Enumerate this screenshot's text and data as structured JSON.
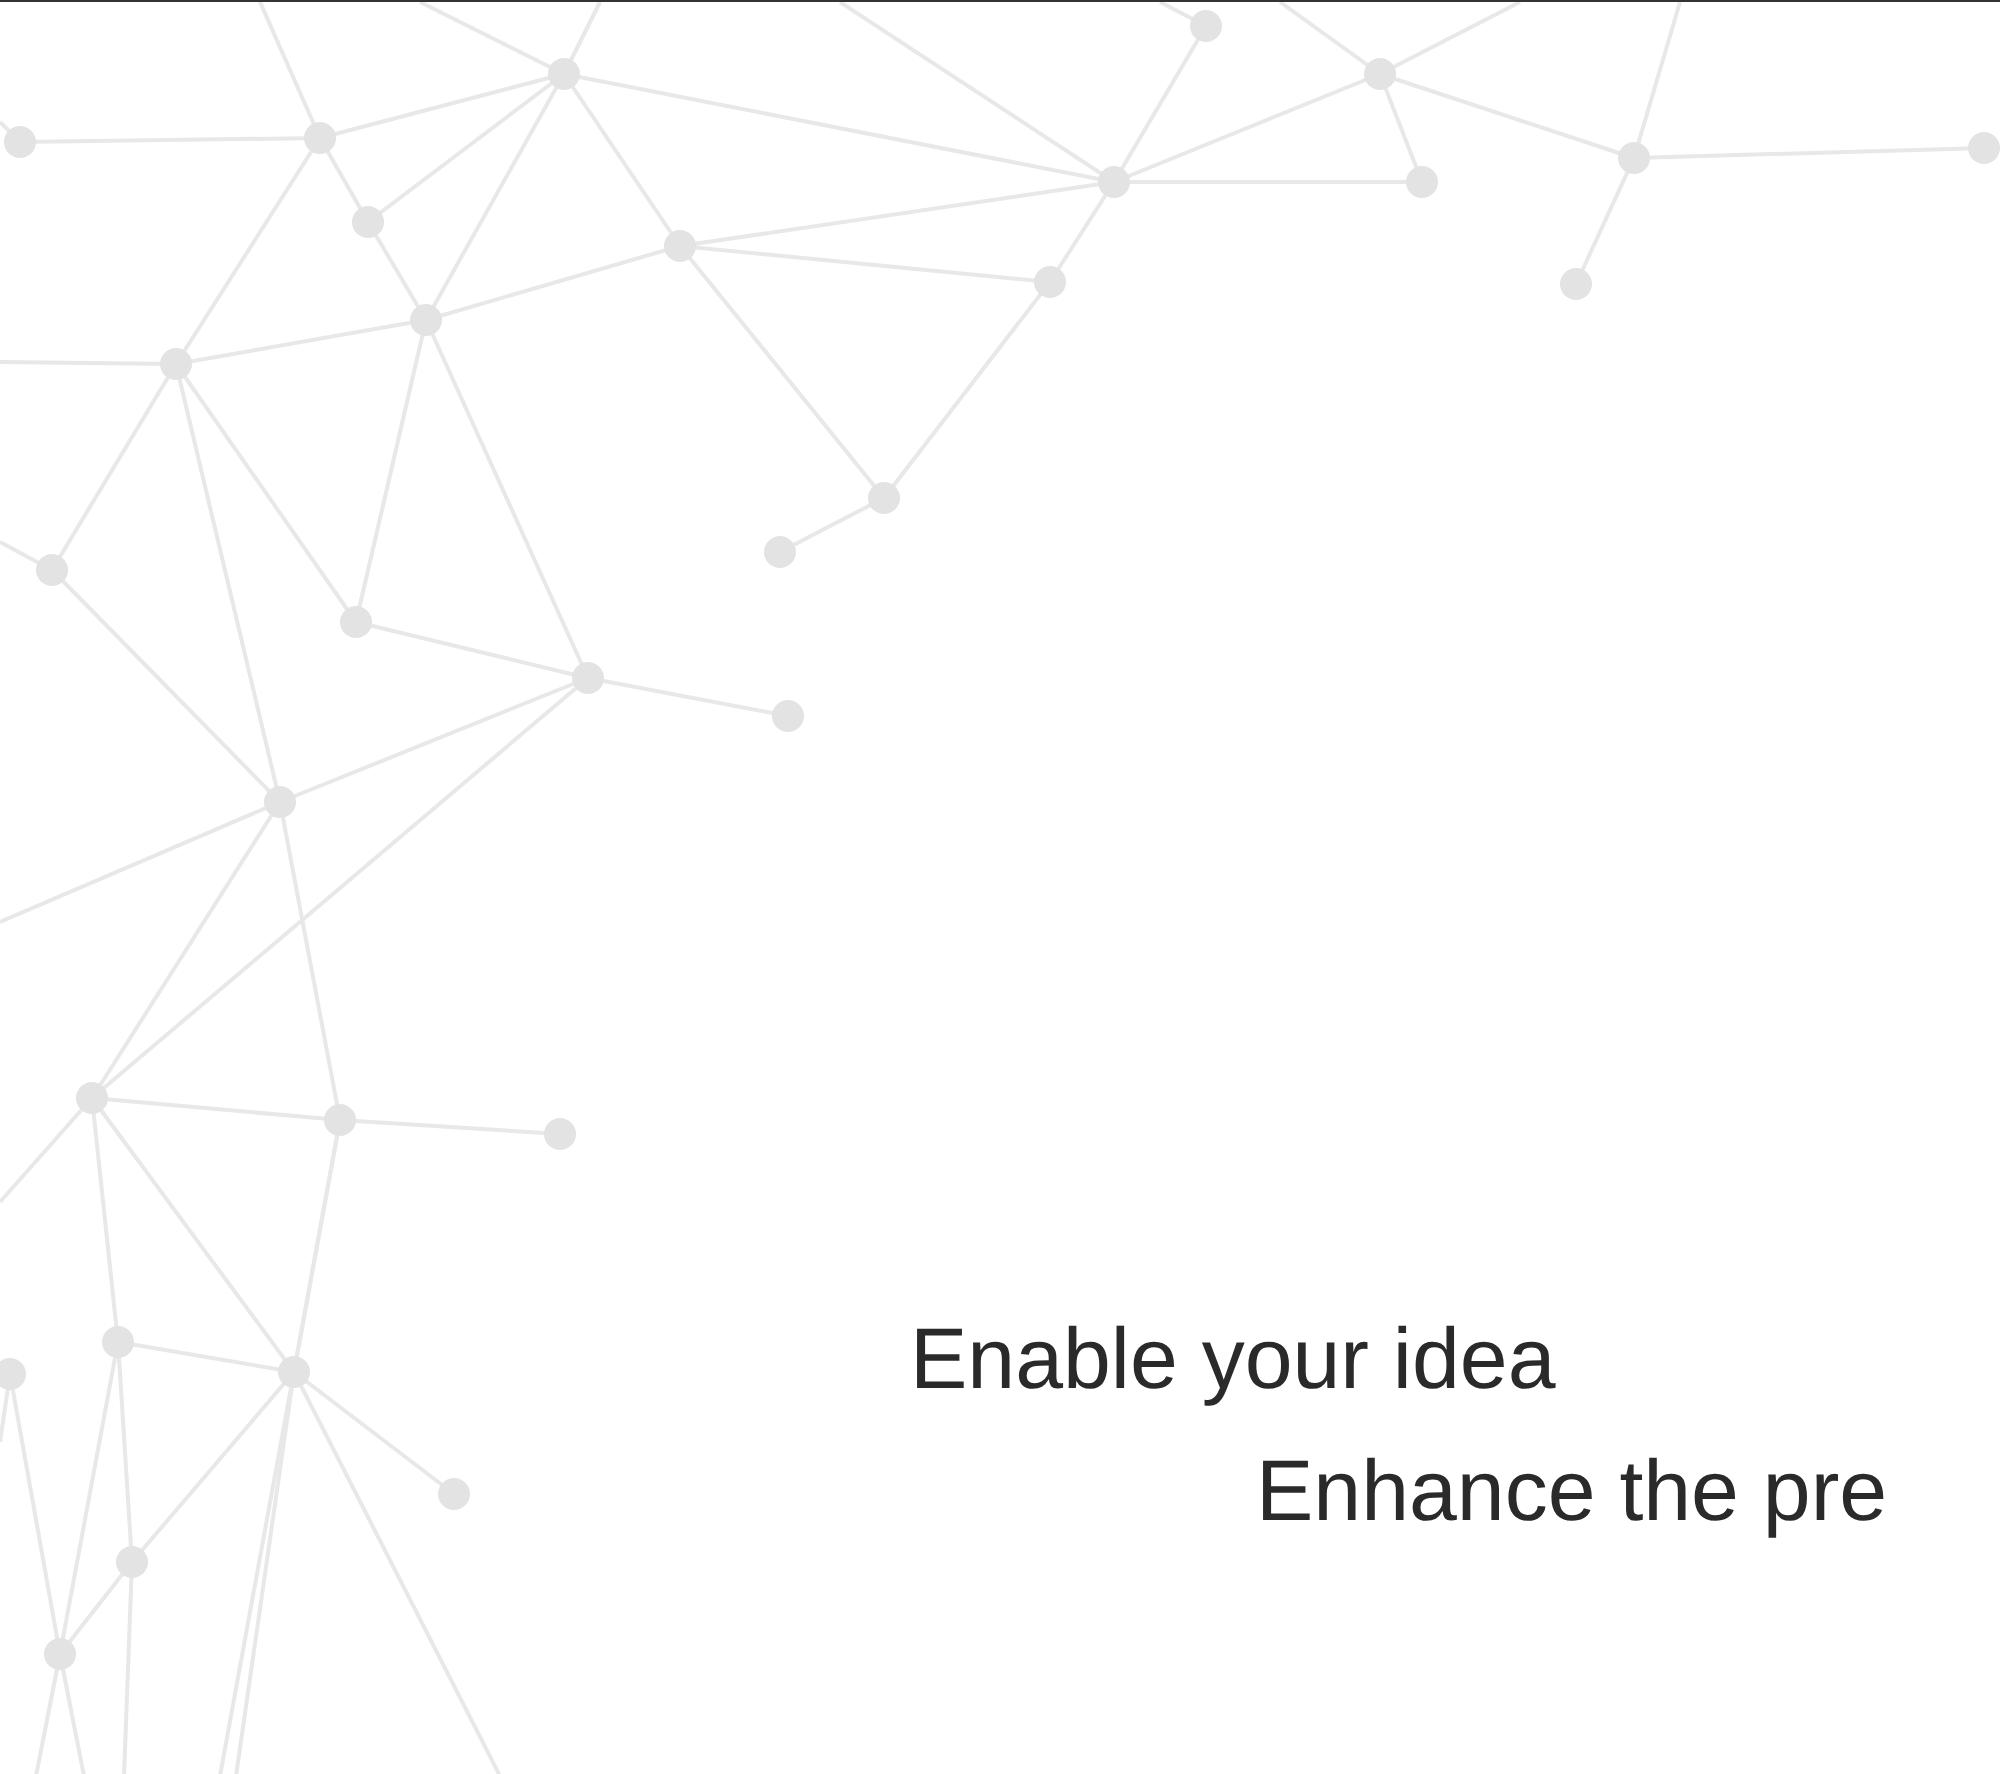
{
  "hero": {
    "headline": "Enable your idea",
    "subheadline": "Enhance the pre"
  }
}
